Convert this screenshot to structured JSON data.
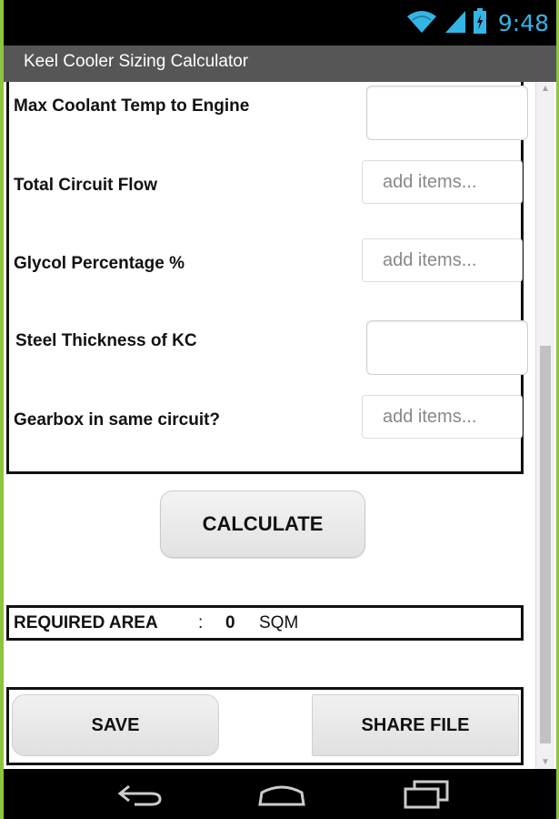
{
  "status_bar": {
    "time": "9:48"
  },
  "app": {
    "title": "Keel Cooler Sizing Calculator"
  },
  "form": {
    "rows": [
      {
        "label": "Max Coolant Temp to Engine",
        "value": ""
      },
      {
        "label": "Total Circuit Flow",
        "placeholder": "add items..."
      },
      {
        "label": "Glycol Percentage %",
        "placeholder": "add items..."
      },
      {
        "label": "Steel Thickness of KC",
        "value": ""
      },
      {
        "label": "Gearbox in same circuit?",
        "placeholder": "add items..."
      }
    ]
  },
  "calculate_label": "CALCULATE",
  "result": {
    "label": "REQUIRED AREA",
    "separator": ":",
    "value": "0",
    "unit": "SQM"
  },
  "actions": {
    "save_label": "SAVE",
    "share_label": "SHARE FILE"
  },
  "colors": {
    "accent_status": "#33b5e5",
    "title_bar": "#565656",
    "frame_border": "#8cc63f"
  },
  "icons": [
    "wifi-icon",
    "signal-icon",
    "battery-icon",
    "back-icon",
    "home-icon",
    "recents-icon"
  ]
}
